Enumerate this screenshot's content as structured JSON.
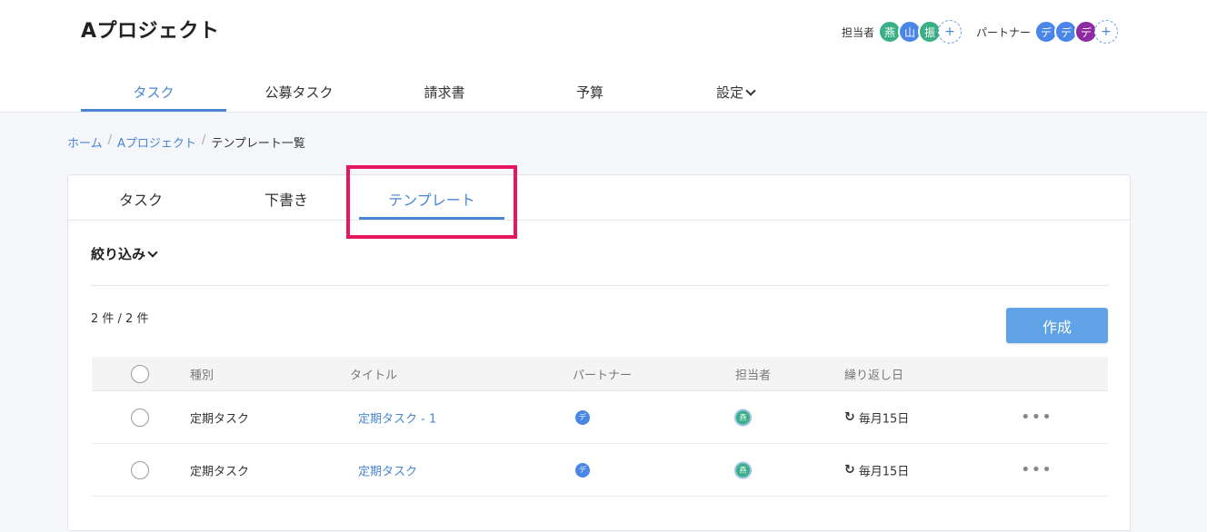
{
  "header": {
    "project_title": "Aプロジェクト",
    "assignee_label": "担当者",
    "assignees": [
      {
        "char": "燕",
        "color": "#3aaf85"
      },
      {
        "char": "山",
        "color": "#4a86e8"
      },
      {
        "char": "振",
        "color": "#3aaf85"
      }
    ],
    "partner_label": "パートナー",
    "partners": [
      {
        "char": "デ",
        "color": "#4a86e8"
      },
      {
        "char": "デ",
        "color": "#4a86e8"
      },
      {
        "char": "デ",
        "color": "#8e2ba3"
      }
    ],
    "add_symbol": "+"
  },
  "main_nav": {
    "items": [
      "タスク",
      "公募タスク",
      "請求書",
      "予算",
      "設定"
    ],
    "active_index": 0
  },
  "breadcrumb": {
    "home": "ホーム",
    "project": "Aプロジェクト",
    "current": "テンプレート一覧",
    "separator": "/"
  },
  "sub_tabs": {
    "items": [
      "タスク",
      "下書き",
      "テンプレート"
    ],
    "active_index": 2
  },
  "filter_label": "絞り込み",
  "count_text": "2 件 / 2 件",
  "create_label": "作成",
  "table": {
    "headers": [
      "種別",
      "タイトル",
      "パートナー",
      "担当者",
      "繰り返し日"
    ],
    "rows": [
      {
        "type": "定期タスク",
        "title": "定期タスク - 1",
        "partner": "デ",
        "owner": "燕",
        "repeat": "毎月15日"
      },
      {
        "type": "定期タスク",
        "title": "定期タスク",
        "partner": "デ",
        "owner": "燕",
        "repeat": "毎月15日"
      }
    ],
    "more_symbol": "•••",
    "repeat_symbol": "↻"
  },
  "colors": {
    "accent": "#4a86d4",
    "highlight": "#e8175d",
    "button": "#5fa3e6",
    "partner_avatar": "#4a86e8",
    "owner_avatar": "#3aaf85"
  }
}
